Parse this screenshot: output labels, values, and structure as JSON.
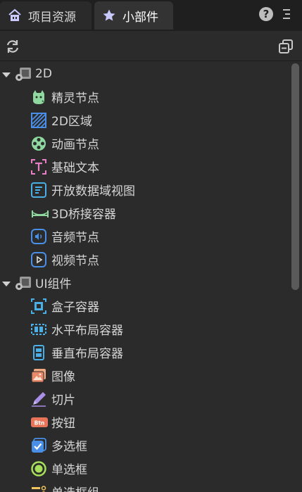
{
  "tabs": [
    {
      "label": "项目资源",
      "icon": "home-icon",
      "active": false
    },
    {
      "label": "小部件",
      "icon": "star-icon",
      "active": true
    }
  ],
  "header_icons": {
    "help": "help-icon",
    "menu": "menu-icon"
  },
  "toolbar": {
    "refresh": "refresh-icon",
    "collapse_all": "collapse-all-icon"
  },
  "groups": [
    {
      "label": "2D",
      "icon": "widget-group-icon",
      "items": [
        {
          "label": "精灵节点",
          "icon": "sprite-icon"
        },
        {
          "label": "2D区域",
          "icon": "area-2d-icon"
        },
        {
          "label": "动画节点",
          "icon": "animation-icon"
        },
        {
          "label": "基础文本",
          "icon": "text-icon"
        },
        {
          "label": "开放数据域视图",
          "icon": "open-data-view-icon"
        },
        {
          "label": "3D桥接容器",
          "icon": "bridge-icon"
        },
        {
          "label": "音频节点",
          "icon": "audio-icon"
        },
        {
          "label": "视频节点",
          "icon": "video-icon"
        }
      ]
    },
    {
      "label": "UI组件",
      "icon": "widget-group-icon",
      "items": [
        {
          "label": "盒子容器",
          "icon": "box-container-icon"
        },
        {
          "label": "水平布局容器",
          "icon": "hbox-icon"
        },
        {
          "label": "垂直布局容器",
          "icon": "vbox-icon"
        },
        {
          "label": "图像",
          "icon": "image-icon"
        },
        {
          "label": "切片",
          "icon": "slice-icon"
        },
        {
          "label": "按钮",
          "icon": "button-icon"
        },
        {
          "label": "多选框",
          "icon": "checkbox-icon"
        },
        {
          "label": "单选框",
          "icon": "radio-icon"
        },
        {
          "label": "单选框组",
          "icon": "radio-group-icon"
        }
      ]
    }
  ],
  "colors": {
    "background": "#2b2b2b",
    "tabbar": "#1f1f1f",
    "accent_blue": "#4a8fe7",
    "accent_green": "#8fd9a0",
    "accent_pink": "#e77fc6"
  },
  "button_icon_text": "Btn"
}
